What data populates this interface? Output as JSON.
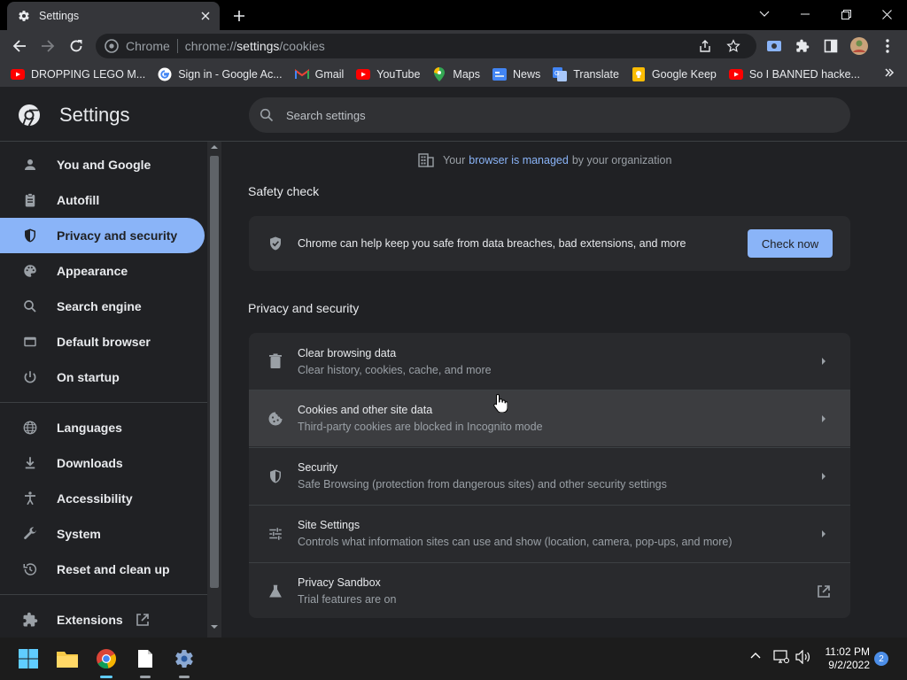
{
  "browser": {
    "tab_title": "Settings",
    "omnibox": {
      "origin_label": "Chrome",
      "url_scheme": "chrome://",
      "url_host": "settings",
      "url_path": "/cookies"
    },
    "bookmarks": [
      {
        "label": "DROPPING LEGO M...",
        "icon": "youtube-icon"
      },
      {
        "label": "Sign in - Google Ac...",
        "icon": "google-icon"
      },
      {
        "label": "Gmail",
        "icon": "gmail-icon"
      },
      {
        "label": "YouTube",
        "icon": "youtube-icon"
      },
      {
        "label": "Maps",
        "icon": "maps-icon"
      },
      {
        "label": "News",
        "icon": "news-icon"
      },
      {
        "label": "Translate",
        "icon": "translate-icon"
      },
      {
        "label": "Google Keep",
        "icon": "keep-icon"
      },
      {
        "label": "So I BANNED hacke...",
        "icon": "youtube-icon"
      }
    ]
  },
  "settings": {
    "title": "Settings",
    "search_placeholder": "Search settings",
    "nav": [
      {
        "label": "You and Google",
        "icon": "person-icon"
      },
      {
        "label": "Autofill",
        "icon": "clipboard-icon"
      },
      {
        "label": "Privacy and security",
        "icon": "shield-icon",
        "active": true
      },
      {
        "label": "Appearance",
        "icon": "palette-icon"
      },
      {
        "label": "Search engine",
        "icon": "search-icon"
      },
      {
        "label": "Default browser",
        "icon": "browser-icon"
      },
      {
        "label": "On startup",
        "icon": "power-icon"
      },
      {
        "label": "Languages",
        "icon": "globe-icon"
      },
      {
        "label": "Downloads",
        "icon": "download-icon"
      },
      {
        "label": "Accessibility",
        "icon": "accessibility-icon"
      },
      {
        "label": "System",
        "icon": "wrench-icon"
      },
      {
        "label": "Reset and clean up",
        "icon": "history-icon"
      },
      {
        "label": "Extensions",
        "icon": "puzzle-icon"
      }
    ],
    "managed": {
      "prefix": "Your",
      "link": "browser is managed",
      "suffix": "by your organization"
    },
    "safety_check": {
      "heading": "Safety check",
      "text": "Chrome can help keep you safe from data breaches, bad extensions, and more",
      "button": "Check now"
    },
    "privacy": {
      "heading": "Privacy and security",
      "rows": [
        {
          "title": "Clear browsing data",
          "subtitle": "Clear history, cookies, cache, and more",
          "icon": "trash-icon"
        },
        {
          "title": "Cookies and other site data",
          "subtitle": "Third-party cookies are blocked in Incognito mode",
          "icon": "cookie-icon"
        },
        {
          "title": "Security",
          "subtitle": "Safe Browsing (protection from dangerous sites) and other security settings",
          "icon": "shield-icon"
        },
        {
          "title": "Site Settings",
          "subtitle": "Controls what information sites can use and show (location, camera, pop-ups, and more)",
          "icon": "tune-icon"
        },
        {
          "title": "Privacy Sandbox",
          "subtitle": "Trial features are on",
          "icon": "flask-icon"
        }
      ]
    }
  },
  "taskbar": {
    "time": "11:02 PM",
    "date": "9/2/2022",
    "notifications": "2"
  },
  "colors": {
    "accent": "#8ab4f8",
    "background": "#202124",
    "card": "#292a2d"
  }
}
